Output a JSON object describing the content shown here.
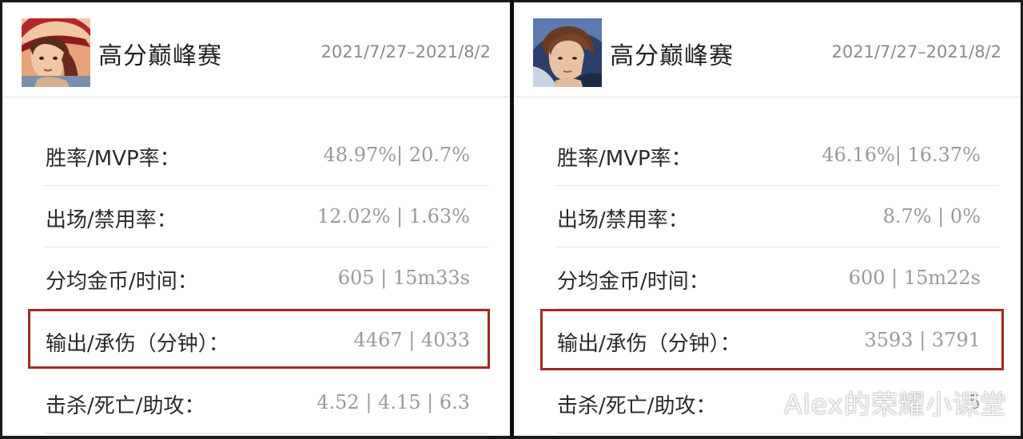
{
  "panels": [
    {
      "hero": "female-hero-red-hat",
      "title": "高分巅峰赛",
      "date_range": "2021/7/27–2021/8/2",
      "stats": [
        {
          "label": "胜率/MVP率：",
          "value": "48.97%| 20.7%"
        },
        {
          "label": "出场/禁用率：",
          "value": "12.02% | 1.63%"
        },
        {
          "label": "分均金币/时间：",
          "value": "605 | 15m33s"
        },
        {
          "label": "输出/承伤（分钟）：",
          "value": "4467 | 4033"
        },
        {
          "label": "击杀/死亡/助攻：",
          "value": "4.52 | 4.15 | 6.3"
        }
      ],
      "highlighted_row": 3
    },
    {
      "hero": "male-hero-brown-hair",
      "title": "高分巅峰赛",
      "date_range": "2021/7/27–2021/8/2",
      "stats": [
        {
          "label": "胜率/MVP率：",
          "value": "46.16%| 16.37%"
        },
        {
          "label": "出场/禁用率：",
          "value": "8.7% | 0%"
        },
        {
          "label": "分均金币/时间：",
          "value": "600 | 15m22s"
        },
        {
          "label": "输出/承伤（分钟）：",
          "value": "3593 | 3791"
        },
        {
          "label": "击杀/死亡/助攻：",
          "value": "5"
        }
      ],
      "highlighted_row": 3
    }
  ],
  "watermark": "Alex的荣耀小课堂",
  "colors": {
    "highlight_border": "#a02a24",
    "label_text": "#2a2a2a",
    "value_text": "#9a9a9a",
    "date_text": "#8a8a8a"
  }
}
